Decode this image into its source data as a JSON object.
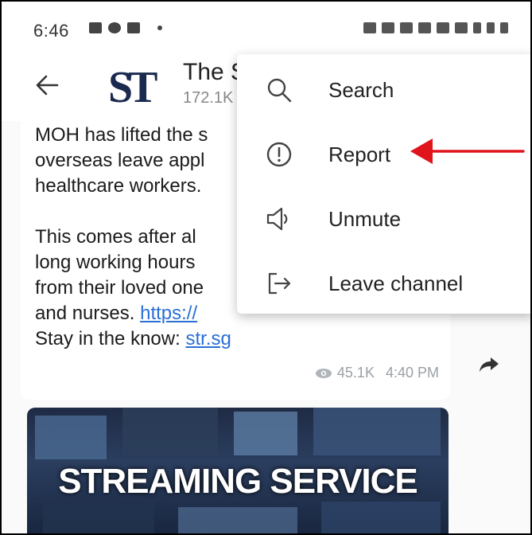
{
  "status_bar": {
    "time": "6:46"
  },
  "channel": {
    "logo": "ST",
    "title": "The S",
    "subtitle": "172.1K"
  },
  "message": {
    "lines": [
      "MOH has lifted the s",
      "overseas leave appl",
      "healthcare workers."
    ],
    "lines2": [
      "This comes after al",
      "long working hours",
      "from their loved one"
    ],
    "last_line_prefix": "and nurses. ",
    "last_line_link": "https://",
    "stay_prefix": "Stay in the know: ",
    "stay_link": "str.sg",
    "views": "45.1K",
    "time": "4:40 PM"
  },
  "media": {
    "overlay_text": "STREAMING SERVICE"
  },
  "menu": {
    "items": [
      {
        "label": "Search",
        "icon": "search-icon"
      },
      {
        "label": "Report",
        "icon": "report-icon"
      },
      {
        "label": "Unmute",
        "icon": "speaker-icon"
      },
      {
        "label": "Leave channel",
        "icon": "leave-icon"
      }
    ]
  },
  "colors": {
    "annotation_arrow": "#e0141b",
    "link": "#2a6fd6",
    "logo": "#1a2a4f"
  }
}
